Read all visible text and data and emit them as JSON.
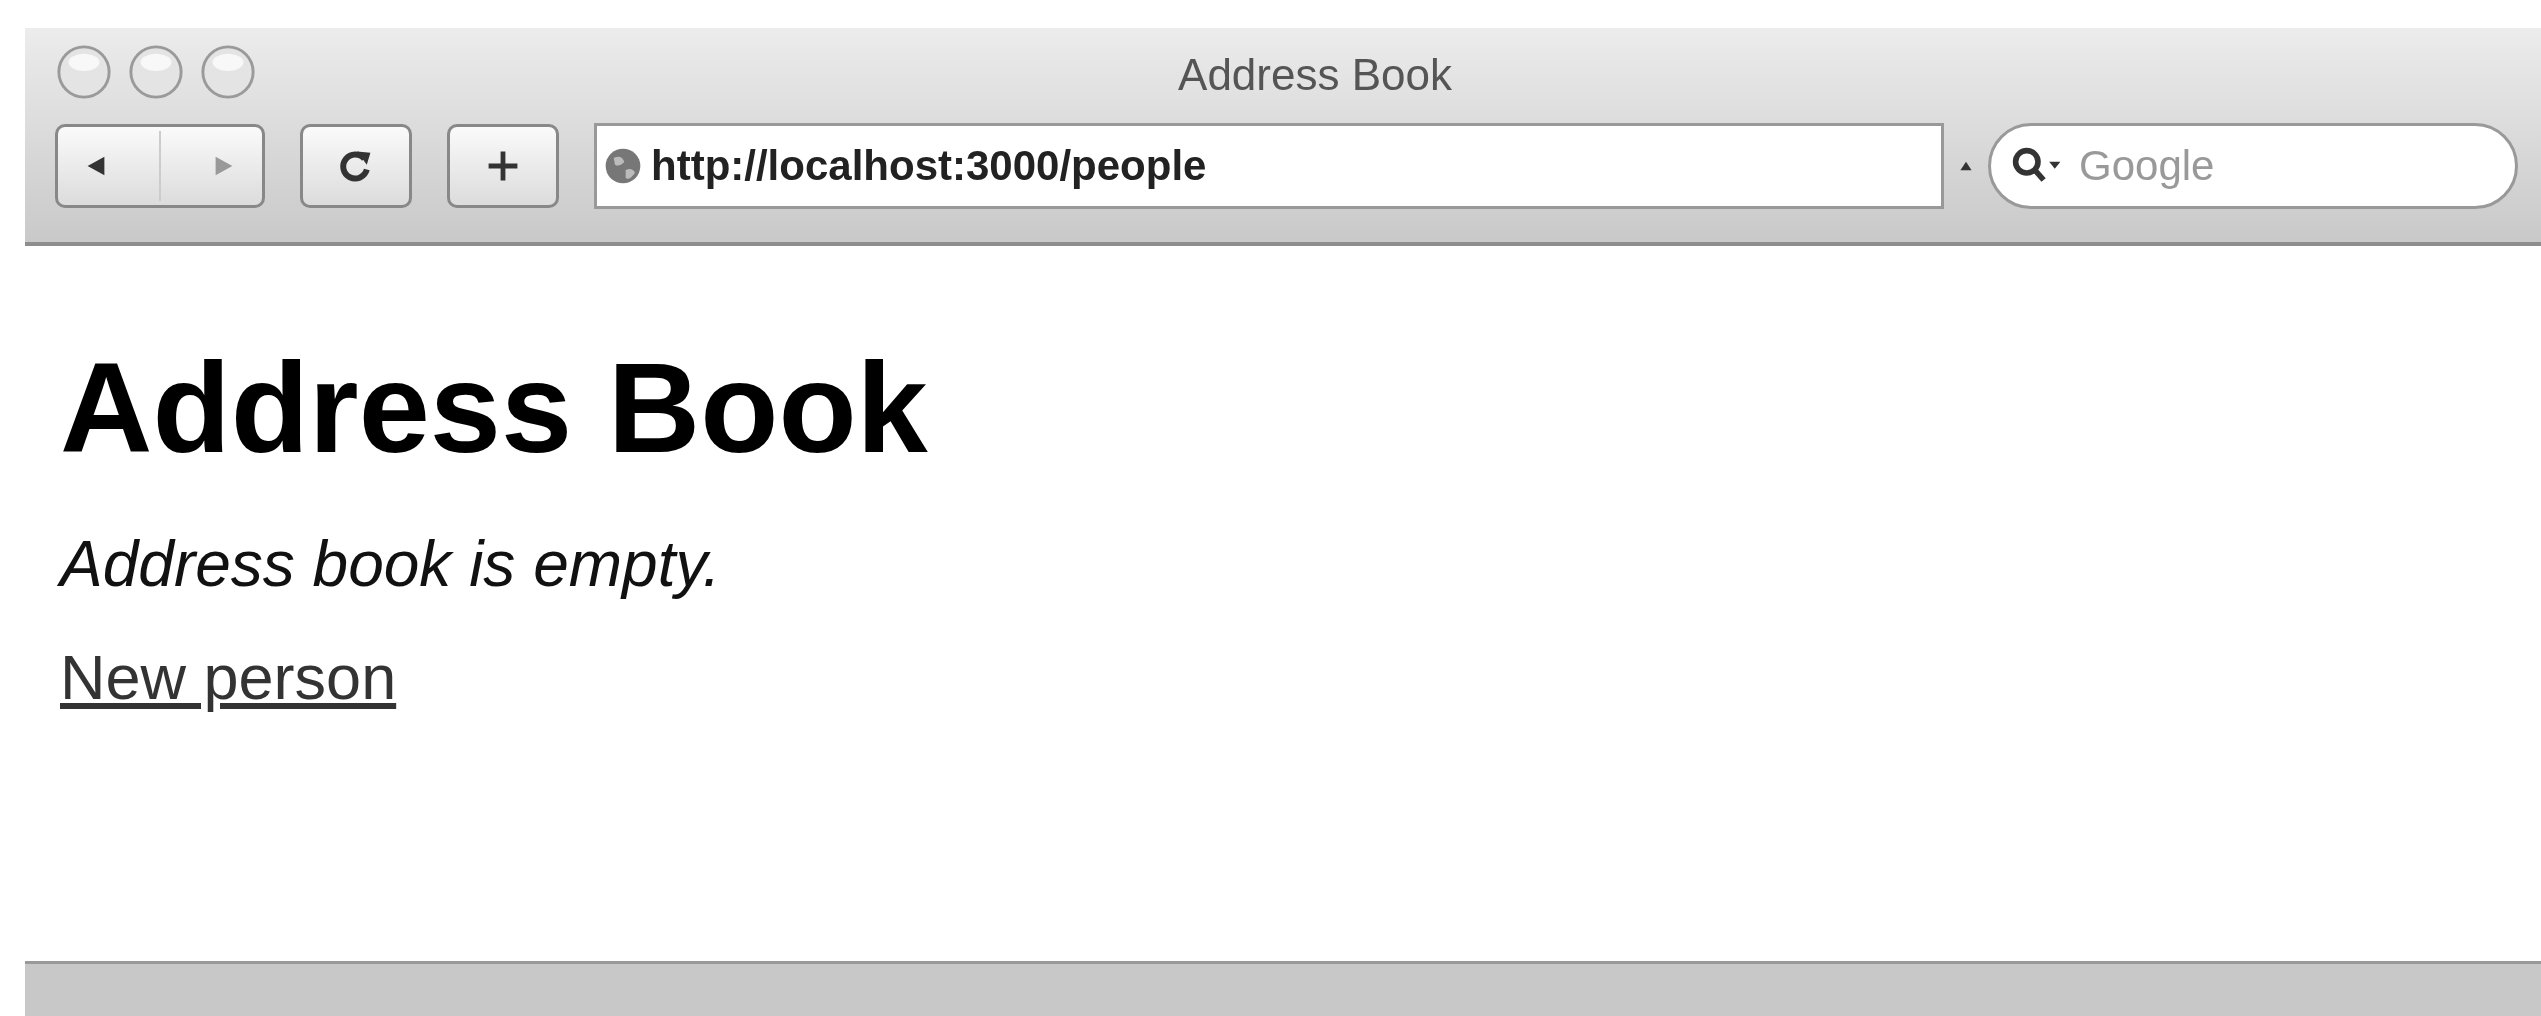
{
  "window": {
    "title": "Address Book"
  },
  "toolbar": {
    "address": "http://localhost:3000/people",
    "search": {
      "placeholder": "Google"
    }
  },
  "page": {
    "heading": "Address Book",
    "message": "Address book is empty.",
    "link": "New person"
  }
}
